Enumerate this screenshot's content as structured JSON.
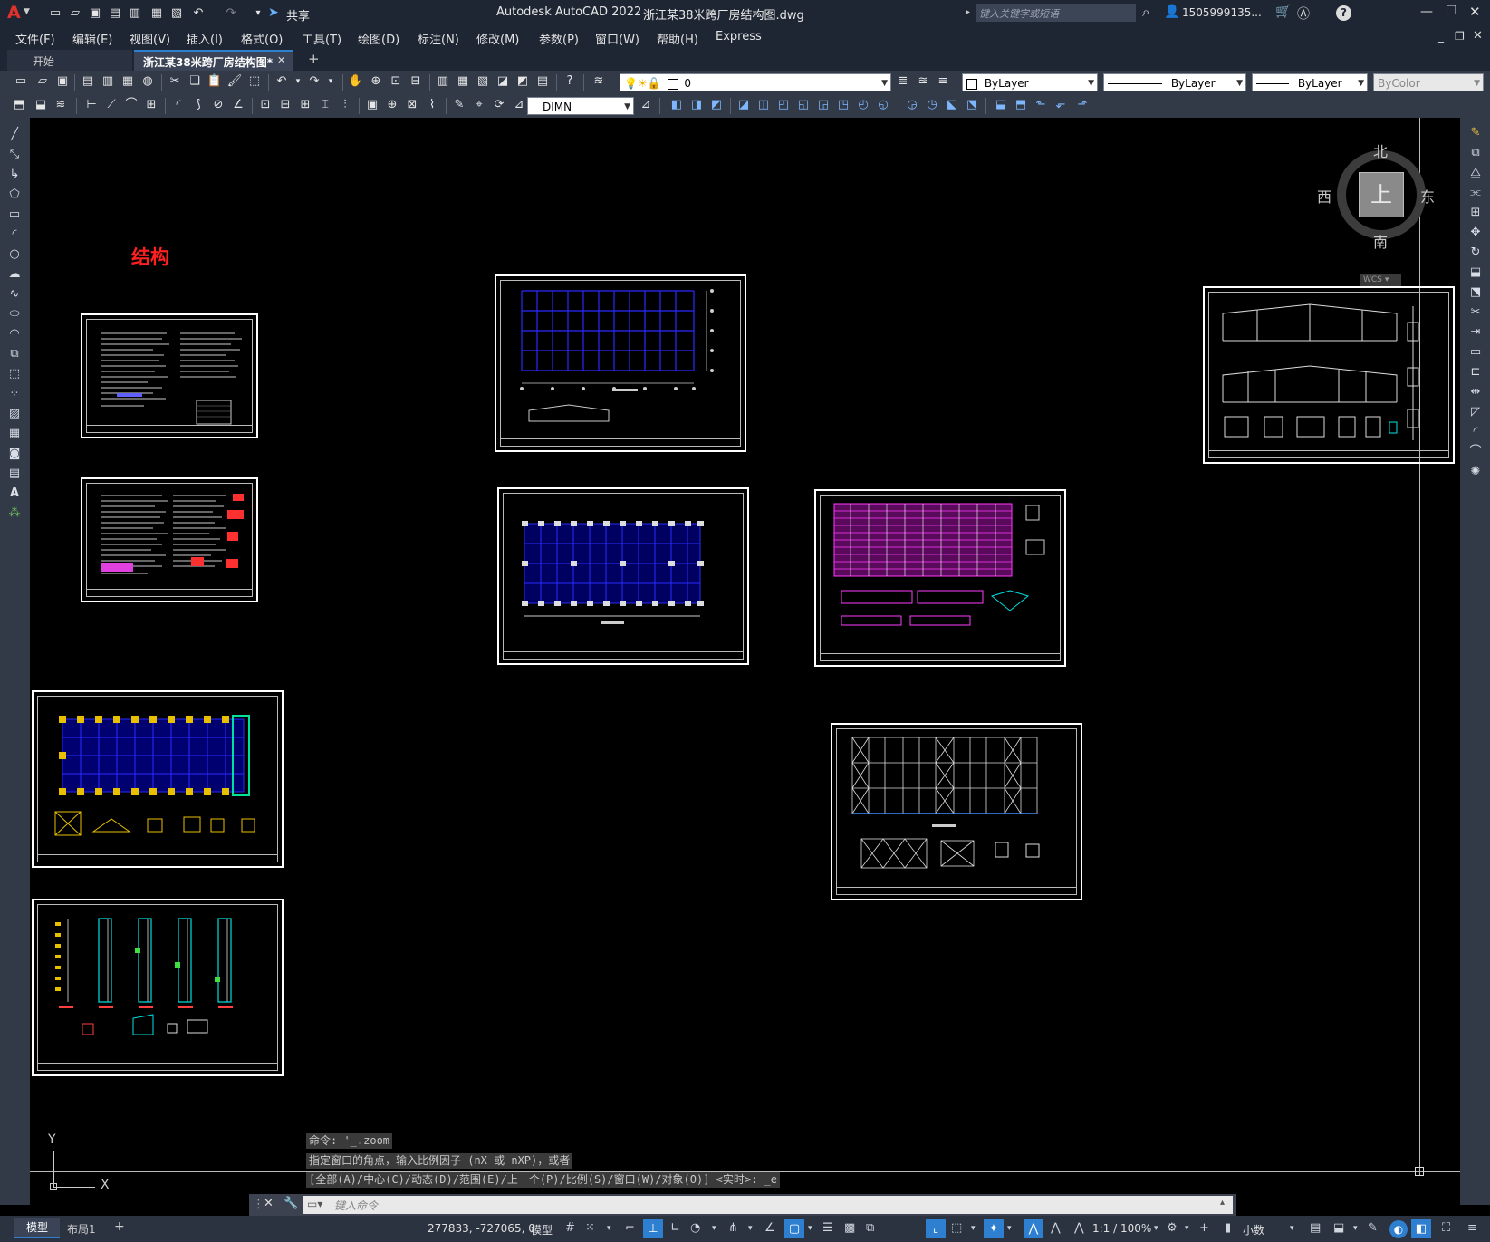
{
  "app": {
    "logo": "A",
    "title": "Autodesk AutoCAD 2022",
    "filename": "浙江某38米跨厂房结构图.dwg",
    "share_label": "共享",
    "search_placeholder": "键入关键字或短语",
    "user": "1505999135...",
    "help": "?"
  },
  "menu": [
    "文件(F)",
    "编辑(E)",
    "视图(V)",
    "插入(I)",
    "格式(O)",
    "工具(T)",
    "绘图(D)",
    "标注(N)",
    "修改(M)",
    "参数(P)",
    "窗口(W)",
    "帮助(H)",
    "Express"
  ],
  "tabs": [
    {
      "label": "开始",
      "active": false
    },
    {
      "label": "浙江某38米跨厂房结构图*",
      "active": true
    }
  ],
  "tab_add": "+",
  "tab_close": "✕",
  "properties": {
    "layer": "0",
    "color": "ByLayer",
    "linetype": "ByLayer",
    "lineweight": "ByLayer",
    "plotstyle": "ByColor"
  },
  "dimstyle": "DIMN",
  "canvas_label": "结构",
  "viewcube": {
    "north": "北",
    "south": "南",
    "east": "东",
    "west": "西",
    "top": "上",
    "wcs": "WCS"
  },
  "ucs": {
    "y": "Y",
    "x": "X"
  },
  "command_history": [
    "命令: '_.zoom",
    "指定窗口的角点，输入比例因子 (nX 或 nXP)，或者",
    "[全部(A)/中心(C)/动态(D)/范围(E)/上一个(P)/比例(S)/窗口(W)/对象(O)] <实时>: _e"
  ],
  "command_placeholder": "键入命令",
  "layout_tabs": [
    "模型",
    "布局1"
  ],
  "status": {
    "coords": "277833, -727065, 0",
    "model": "模型",
    "scale": "1:1 / 100%",
    "units": "小数"
  },
  "colors": {
    "accent": "#2f7fd1",
    "grid_blue": "#2a2aff",
    "magenta": "#ff3cff",
    "yellow": "#e8c000",
    "cyan": "#00e0e0",
    "label_red": "#ff2020"
  }
}
